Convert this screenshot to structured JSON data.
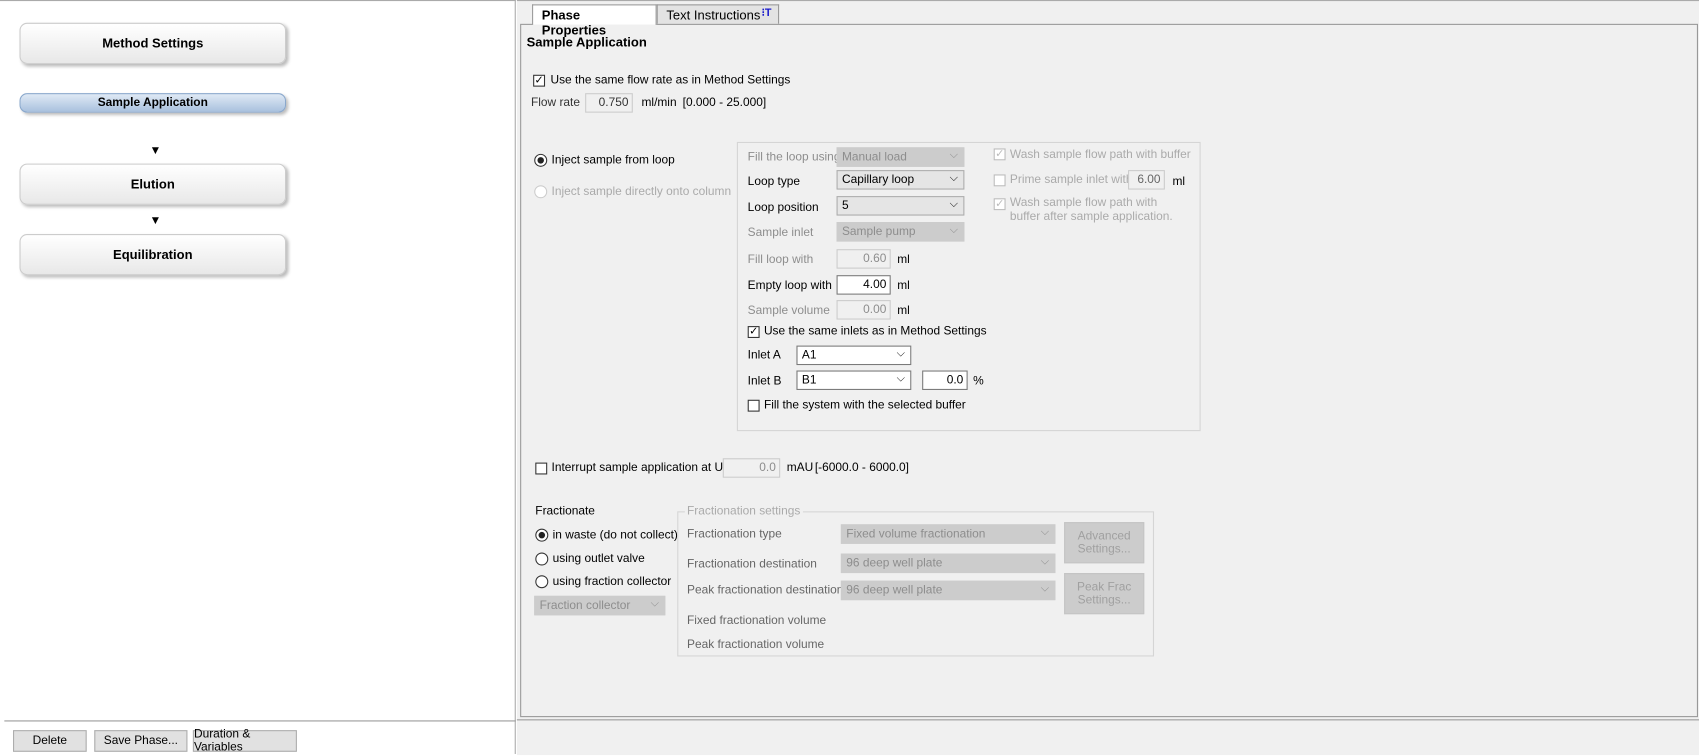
{
  "phases": {
    "items": [
      {
        "label": "Method Settings"
      },
      {
        "label": "Sample Application"
      },
      {
        "label": "Elution"
      },
      {
        "label": "Equilibration"
      }
    ],
    "selected": "Sample Application"
  },
  "bottom_buttons": {
    "delete": "Delete",
    "save_phase": "Save Phase...",
    "duration": "Duration & Variables"
  },
  "tabs": {
    "phase_properties": "Phase Properties",
    "text_instructions": "Text Instructions",
    "text_icon": "⁝T"
  },
  "section_title": "Sample Application",
  "flow": {
    "same_flow_label": "Use the same flow rate as in Method Settings",
    "same_flow_checked": true,
    "flow_rate_label": "Flow rate",
    "flow_rate_value": "0.750",
    "unit": "ml/min",
    "range": "[0.000 - 25.000]"
  },
  "inject": {
    "from_loop": "Inject sample from loop",
    "directly": "Inject sample directly onto column"
  },
  "loop": {
    "fill_using_label": "Fill the loop using",
    "fill_using_value": "Manual load",
    "loop_type_label": "Loop type",
    "loop_type_value": "Capillary loop",
    "loop_position_label": "Loop position",
    "loop_position_value": "5",
    "sample_inlet_label": "Sample inlet",
    "sample_inlet_value": "Sample pump",
    "fill_loop_label": "Fill loop with",
    "fill_loop_value": "0.60",
    "empty_loop_label": "Empty loop with",
    "empty_loop_value": "4.00",
    "sample_volume_label": "Sample volume",
    "sample_volume_value": "0.00",
    "ml": "ml",
    "same_inlets_label": "Use the same inlets as in Method Settings",
    "inlet_a_label": "Inlet A",
    "inlet_a_value": "A1",
    "inlet_b_label": "Inlet B",
    "inlet_b_value": "B1",
    "inlet_b_percent": "0.0",
    "percent": "%",
    "fill_system_label": "Fill the system with the selected buffer",
    "wash_label": "Wash sample flow path with buffer",
    "prime_label": "Prime sample inlet with",
    "prime_value": "6.00",
    "wash_after_label1": "Wash sample flow path with",
    "wash_after_label2": "buffer after sample application."
  },
  "interrupt": {
    "label": "Interrupt sample application at UV",
    "value": "0.0",
    "unit": "mAU",
    "range": "[-6000.0 - 6000.0]"
  },
  "fractionate": {
    "title": "Fractionate",
    "in_waste": "in waste (do not collect)",
    "outlet_valve": "using outlet valve",
    "fraction_collector": "using fraction collector",
    "collector_select": "Fraction collector"
  },
  "fractionation_settings": {
    "title": "Fractionation settings",
    "type_label": "Fractionation type",
    "type_value": "Fixed volume fractionation",
    "dest_label": "Fractionation destination",
    "dest_value": "96 deep well plate",
    "peak_dest_label": "Peak fractionation destination",
    "peak_dest_value": "96 deep well plate",
    "fixed_vol_label": "Fixed fractionation volume",
    "peak_vol_label": "Peak fractionation volume",
    "advanced_btn1": "Advanced",
    "advanced_btn2": "Settings...",
    "peak_btn1": "Peak Frac",
    "peak_btn2": "Settings..."
  }
}
